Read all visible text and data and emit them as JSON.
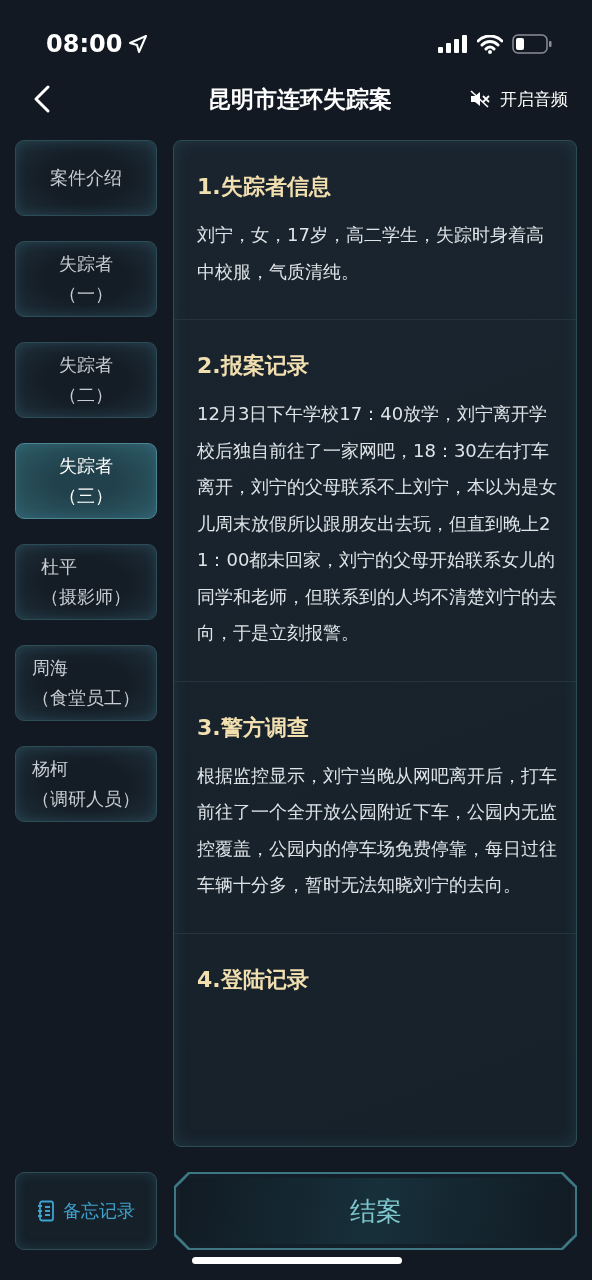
{
  "status_bar": {
    "time": "08:00"
  },
  "header": {
    "title": "昆明市连环失踪案",
    "audio_label": "开启音频",
    "audio_on": false
  },
  "sidebar": {
    "items": [
      {
        "lines": [
          "案件介绍"
        ],
        "selected": false
      },
      {
        "lines": [
          "失踪者",
          "（一）"
        ],
        "selected": false
      },
      {
        "lines": [
          "失踪者",
          "（二）"
        ],
        "selected": false
      },
      {
        "lines": [
          "失踪者",
          "（三）"
        ],
        "selected": true
      },
      {
        "lines": [
          "杜平",
          "（摄影师）"
        ],
        "selected": false
      },
      {
        "lines": [
          "周海",
          "（食堂员工）"
        ],
        "selected": false
      },
      {
        "lines": [
          "杨柯",
          "（调研人员）"
        ],
        "selected": false
      }
    ]
  },
  "sections": [
    {
      "heading": "1.失踪者信息",
      "text": "刘宁，女，17岁，高二学生，失踪时身着高中校服，气质清纯。"
    },
    {
      "heading": "2.报案记录",
      "text": "12月3日下午学校17：40放学，刘宁离开学校后独自前往了一家网吧，18：30左右打车离开，刘宁的父母联系不上刘宁，本以为是女儿周末放假所以跟朋友出去玩，但直到晚上21：00都未回家，刘宁的父母开始联系女儿的同学和老师，但联系到的人均不清楚刘宁的去向，于是立刻报警。"
    },
    {
      "heading": "3.警方调查",
      "text": "根据监控显示，刘宁当晚从网吧离开后，打车前往了一个全开放公园附近下车，公园内无监控覆盖，公园内的停车场免费停靠，每日过往车辆十分多，暂时无法知晓刘宁的去向。"
    },
    {
      "heading": "4.登陆记录"
    }
  ],
  "footer": {
    "memo_label": "备忘记录",
    "close_label": "结案"
  }
}
